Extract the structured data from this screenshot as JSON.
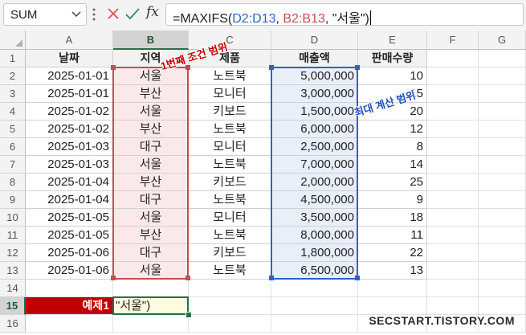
{
  "formula_bar": {
    "name_box": "SUM",
    "fx_label": "fx",
    "formula_parts": [
      {
        "text": "=MAXIFS(",
        "color": "default"
      },
      {
        "text": "D2:D13",
        "color": "blue"
      },
      {
        "text": ", ",
        "color": "default"
      },
      {
        "text": "B2:B13",
        "color": "red"
      },
      {
        "text": ", \"서울\")",
        "color": "default"
      }
    ]
  },
  "columns": [
    "A",
    "B",
    "C",
    "D",
    "E",
    "F",
    "G"
  ],
  "rows": [
    "1",
    "2",
    "3",
    "4",
    "5",
    "6",
    "7",
    "8",
    "9",
    "10",
    "11",
    "12",
    "13",
    "14",
    "15",
    "16"
  ],
  "table": {
    "headers": [
      "날짜",
      "지역",
      "제품",
      "매출액",
      "판매수량"
    ],
    "rows": [
      [
        "2025-01-01",
        "서울",
        "노트북",
        "5,000,000",
        "10"
      ],
      [
        "2025-01-01",
        "부산",
        "모니터",
        "3,000,000",
        "15"
      ],
      [
        "2025-01-02",
        "서울",
        "키보드",
        "1,500,000",
        "20"
      ],
      [
        "2025-01-02",
        "부산",
        "노트북",
        "6,000,000",
        "12"
      ],
      [
        "2025-01-03",
        "대구",
        "모니터",
        "2,500,000",
        "8"
      ],
      [
        "2025-01-03",
        "서울",
        "노트북",
        "7,000,000",
        "14"
      ],
      [
        "2025-01-04",
        "부산",
        "키보드",
        "2,000,000",
        "25"
      ],
      [
        "2025-01-04",
        "대구",
        "노트북",
        "4,500,000",
        "9"
      ],
      [
        "2025-01-05",
        "서울",
        "모니터",
        "3,500,000",
        "18"
      ],
      [
        "2025-01-05",
        "부산",
        "노트북",
        "8,000,000",
        "11"
      ],
      [
        "2025-01-06",
        "대구",
        "키보드",
        "1,800,000",
        "22"
      ],
      [
        "2025-01-06",
        "서울",
        "노트북",
        "6,500,000",
        "13"
      ]
    ]
  },
  "example": {
    "label": "예제1",
    "cell_text": "\"서울\")"
  },
  "annotations": {
    "condition_range": "1번째 조건 범위",
    "max_range": "최대 계산 범위"
  },
  "watermark": "SECSTART.TISTORY.COM",
  "colors": {
    "condition_range": "#c0504d",
    "max_range": "#2d63c8",
    "label_bg": "#c00000",
    "selection": "#217346"
  },
  "icons": [
    "chevron-down-icon",
    "more-vertical-icon",
    "cancel-x-icon",
    "confirm-check-icon",
    "function-fx-icon"
  ]
}
